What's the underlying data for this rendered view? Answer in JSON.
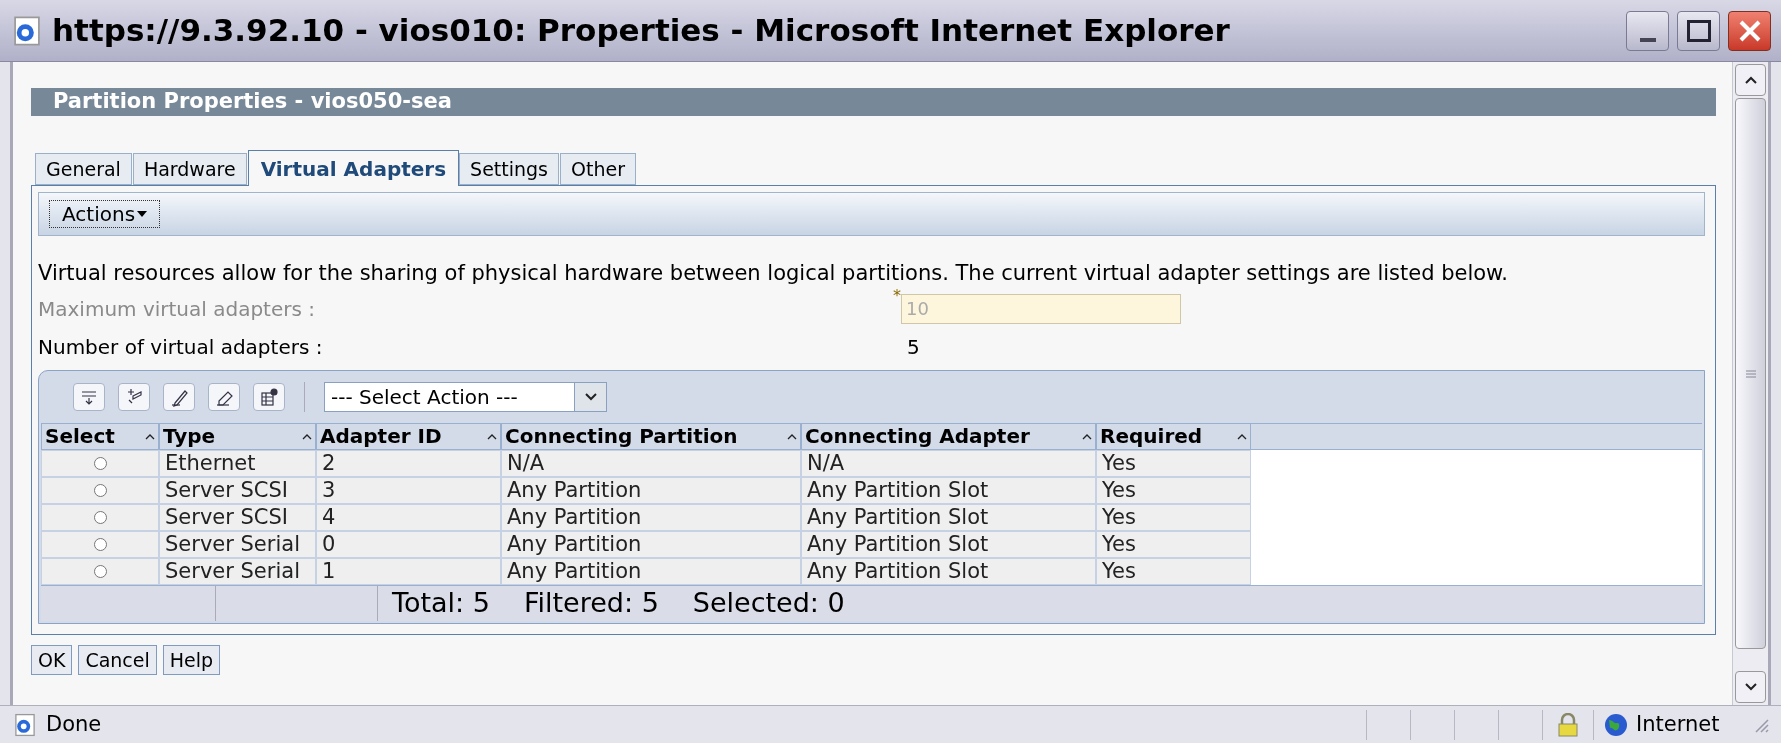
{
  "window": {
    "title": "https://9.3.92.10 - vios010: Properties - Microsoft Internet Explorer"
  },
  "header": "Partition Properties - vios050-sea",
  "tabs": [
    {
      "label": "General",
      "selected": false
    },
    {
      "label": "Hardware",
      "selected": false
    },
    {
      "label": "Virtual Adapters",
      "selected": true
    },
    {
      "label": "Settings",
      "selected": false
    },
    {
      "label": "Other",
      "selected": false
    }
  ],
  "actions_menu": "Actions",
  "description": "Virtual resources allow for the sharing of physical hardware between logical partitions. The current virtual adapter settings are listed below.",
  "fields": [
    {
      "kind": "input",
      "label": "Maximum virtual adapters :",
      "required_mark": "*",
      "value": "10",
      "disabled": true
    },
    {
      "kind": "readout",
      "label": "Number of virtual adapters :",
      "value": "5",
      "disabled": false
    }
  ],
  "table": {
    "select_action": "--- Select Action ---",
    "columns": [
      "Select",
      "Type",
      "Adapter ID",
      "Connecting Partition",
      "Connecting Adapter",
      "Required"
    ],
    "rows": [
      {
        "selected": false,
        "cells": [
          "",
          "Ethernet",
          "2",
          "N/A",
          "N/A",
          "Yes"
        ]
      },
      {
        "selected": false,
        "cells": [
          "",
          "Server SCSI",
          "3",
          "Any Partition",
          "Any Partition Slot",
          "Yes"
        ]
      },
      {
        "selected": false,
        "cells": [
          "",
          "Server SCSI",
          "4",
          "Any Partition",
          "Any Partition Slot",
          "Yes"
        ]
      },
      {
        "selected": false,
        "cells": [
          "",
          "Server Serial",
          "0",
          "Any Partition",
          "Any Partition Slot",
          "Yes"
        ]
      },
      {
        "selected": false,
        "cells": [
          "",
          "Server Serial",
          "1",
          "Any Partition",
          "Any Partition Slot",
          "Yes"
        ]
      }
    ],
    "footer": [
      "Total: 5",
      "Filtered: 5",
      "Selected: 0"
    ]
  },
  "buttons": [
    "OK",
    "Cancel",
    "Help"
  ],
  "status_bar": {
    "text": "Done",
    "zone": "Internet"
  }
}
